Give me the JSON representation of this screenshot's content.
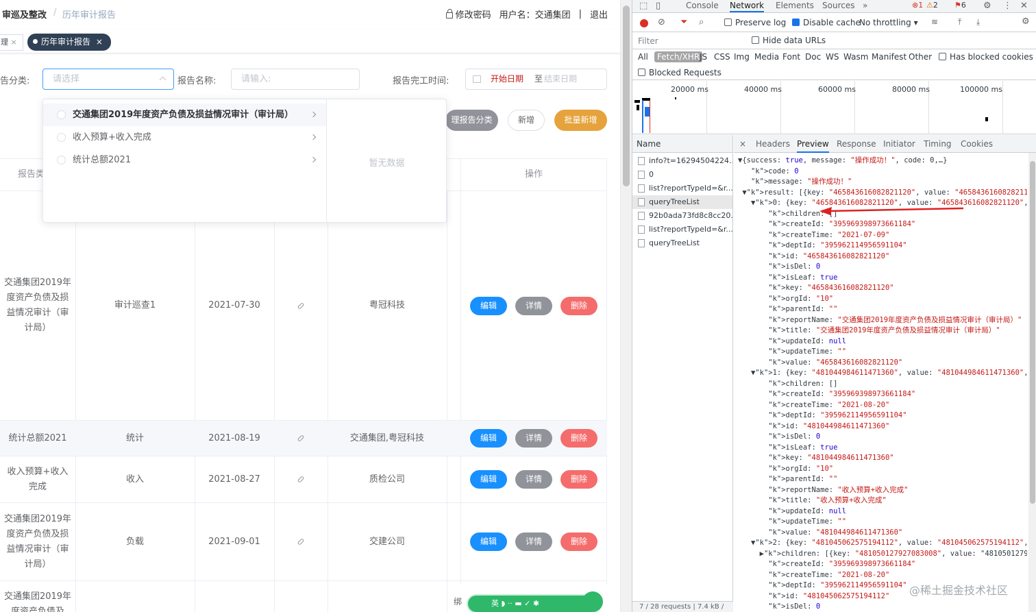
{
  "app": {
    "breadcrumb": [
      "审巡及整改",
      "历年审计报告"
    ],
    "breadcrumb_sep": "/",
    "change_password": "修改密码",
    "user_label": "用户名：交通集团",
    "divider": "|",
    "logout": "退出",
    "tags": [
      {
        "label": "理",
        "close": "×"
      },
      {
        "label": "历年审计报告",
        "close": "×"
      }
    ],
    "filters": {
      "category_label": "告分类:",
      "category_placeholder": "请选择",
      "name_label": "报告名称:",
      "name_placeholder": "请输入:",
      "date_label": "报告完工时间:",
      "date_start": "开始日期",
      "date_sep": "至",
      "date_end": "结束日期"
    },
    "buttons": {
      "manage": "理报告分类",
      "add": "新增",
      "batch_add": "批量新增"
    },
    "dropdown": {
      "items": [
        "交通集团2019年度资产负债及损益情况审计（审计局）",
        "收入预算+收入完成",
        "统计总额2021"
      ],
      "empty": "暂无数据"
    },
    "table": {
      "headers": [
        "报告类",
        "操作"
      ],
      "row_actions": {
        "edit": "编辑",
        "detail": "详情",
        "delete": "删除"
      },
      "rows": [
        {
          "name": "交通集团2019年度资产负债及损益情况审计（审计局）",
          "type": "审计巡查1",
          "date": "2021-07-30",
          "company": "粤冠科技"
        },
        {
          "name": "统计总额2021",
          "type": "统计",
          "date": "2021-08-19",
          "company": "交通集团,粤冠科技"
        },
        {
          "name": "收入预算+收入完成",
          "type": "收入",
          "date": "2021-08-27",
          "company": "质检公司"
        },
        {
          "name": "交通集团2019年度资产负债及损益情况审计（审计局）",
          "type": "负载",
          "date": "2021-09-01",
          "company": "交建公司"
        },
        {
          "name": "交通集团2019年度资产负债及",
          "type": "",
          "date": "",
          "company": ""
        }
      ],
      "partial_last": "绑"
    },
    "ime_bar": "英 ◗ ·· ▬ ✓ ✱"
  },
  "devtools": {
    "tabs": [
      "Console",
      "Network",
      "Elements",
      "Sources",
      "»"
    ],
    "active_tab": "Network",
    "badges": {
      "errors": "1",
      "warnings": "2",
      "issues": "6"
    },
    "preserve_log": "Preserve log",
    "disable_cache": "Disable cache",
    "throttling": "No throttling",
    "filter_placeholder": "Filter",
    "hide_data_urls": "Hide data URLs",
    "types": [
      "All",
      "Fetch/XHR",
      "JS",
      "CSS",
      "Img",
      "Media",
      "Font",
      "Doc",
      "WS",
      "Wasm",
      "Manifest",
      "Other"
    ],
    "has_blocked_cookies": "Has blocked cookies",
    "blocked_requests": "Blocked Requests",
    "timeline_labels": [
      "20000 ms",
      "40000 ms",
      "60000 ms",
      "80000 ms",
      "100000 ms"
    ],
    "name_header": "Name",
    "requests": [
      "info?t=16294504224...",
      "0",
      "list?reportTypeId=&r...",
      "queryTreeList",
      "92b0ada73fd8c8cc20...",
      "list?reportTypeId=&r...",
      "queryTreeList"
    ],
    "selected_request": "queryTreeList",
    "status": "7 / 28 requests | 7.4 kB /",
    "detail_tabs": [
      "×",
      "Headers",
      "Preview",
      "Response",
      "Initiator",
      "Timing",
      "Cookies"
    ],
    "active_detail_tab": "Preview",
    "json_lines": [
      "▼{success: true, message: \"操作成功！\", code: 0,…}",
      "   code: 0",
      "   message: \"操作成功！\"",
      " ▼result: [{key: \"465843616082821120\", value: \"465843616082821120\"",
      "   ▼0: {key: \"465843616082821120\", value: \"465843616082821120\", t",
      "       children: []",
      "       createId: \"395969398973661184\"",
      "       createTime: \"2021-07-09\"",
      "       deptId: \"395962114956591104\"",
      "       id: \"465843616082821120\"",
      "       isDel: 0",
      "       isLeaf: true",
      "       key: \"465843616082821120\"",
      "       orgId: \"10\"",
      "       parentId: \"\"",
      "       reportName: \"交通集团2019年度资产负债及损益情况审计（审计局）\"",
      "       title: \"交通集团2019年度资产负债及损益情况审计（审计局）\"",
      "       updateId: null",
      "       updateTime: \"\"",
      "       value: \"465843616082821120\"",
      "   ▼1: {key: \"481044984611471360\", value: \"481044984611471360\", t",
      "       children: []",
      "       createId: \"395969398973661184\"",
      "       createTime: \"2021-08-20\"",
      "       deptId: \"395962114956591104\"",
      "       id: \"481044984611471360\"",
      "       isDel: 0",
      "       isLeaf: true",
      "       key: \"481044984611471360\"",
      "       orgId: \"10\"",
      "       parentId: \"\"",
      "       reportName: \"收入预算+收入完成\"",
      "       title: \"收入预算+收入完成\"",
      "       updateId: null",
      "       updateTime: \"\"",
      "       value: \"481044984611471360\"",
      "   ▼2: {key: \"481045062575194112\", value: \"481045062575194112\", t",
      "     ▶children: [{key: \"481050127927083008\", value: \"481050127927",
      "       createId: \"395969398973661184\"",
      "       createTime: \"2021-08-20\"",
      "       deptId: \"395962114956591104\"",
      "       id: \"481045062575194112\"",
      "       isDel: 0"
    ],
    "watermark": "@稀土掘金技术社区"
  },
  "colors": {
    "primary": "#409eff",
    "edit": "#1890ff",
    "detail": "#909399",
    "delete": "#f56c6c",
    "batch": "#e6a23c",
    "devtools_accent": "#1a73e8",
    "annotation_arrow": "#e02020"
  }
}
